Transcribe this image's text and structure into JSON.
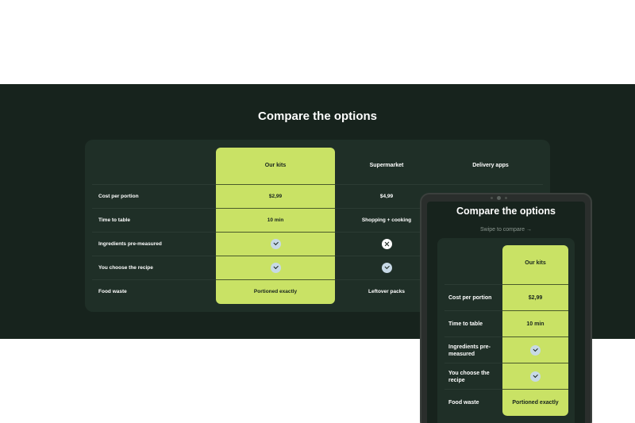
{
  "section": {
    "title": "Compare the options"
  },
  "table": {
    "columns": [
      "Our kits",
      "Supermarket",
      "Delivery apps"
    ],
    "rows": [
      {
        "label": "Cost per portion",
        "kits": "$2,99",
        "supermarket": "$4,99"
      },
      {
        "label": "Time to table",
        "kits": "10 min",
        "supermarket": "Shopping + cooking"
      },
      {
        "label": "Ingredients pre-measured",
        "kits": "check-icon",
        "supermarket": "x-icon"
      },
      {
        "label": "You choose the recipe",
        "kits": "check-icon",
        "supermarket": "check-icon"
      },
      {
        "label": "Food waste",
        "kits": "Portioned exactly",
        "supermarket": "Leftover packs"
      }
    ]
  },
  "tablet": {
    "title": "Compare the options",
    "swipe_hint": "Swipe to compare →",
    "column": "Our kits",
    "rows": [
      {
        "label": "Cost per portion",
        "kits": "$2,99"
      },
      {
        "label": "Time to table",
        "kits": "10 min"
      },
      {
        "label": "Ingredients pre-measured",
        "kits": "check-icon"
      },
      {
        "label": "You choose the recipe",
        "kits": "check-icon"
      },
      {
        "label": "Food waste",
        "kits": "Portioned exactly"
      }
    ]
  },
  "colors": {
    "background_dark": "#17231d",
    "card": "#1f2f27",
    "accent": "#c9e265",
    "check_badge": "#c7d9e6"
  }
}
